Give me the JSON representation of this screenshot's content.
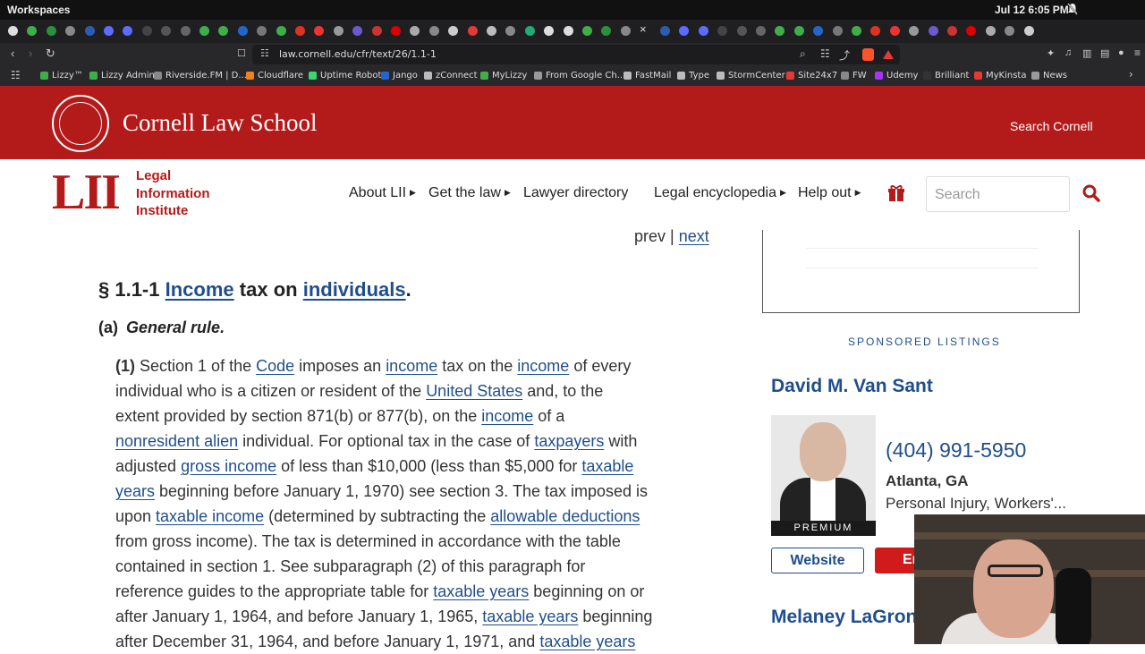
{
  "os": {
    "workspaces": "Workspaces",
    "clock": "Jul 12  6:05 PM"
  },
  "browser": {
    "close_tab_glyph": "×",
    "url": "law.cornell.edu/cfr/text/26/1.1-1",
    "bookmarks": [
      {
        "label": "Lizzy™",
        "color": "#3fae49"
      },
      {
        "label": "Lizzy Admin",
        "color": "#3fae49"
      },
      {
        "label": "Riverside.FM | D...",
        "color": "#888888"
      },
      {
        "label": "Cloudflare",
        "color": "#f38020"
      },
      {
        "label": "Uptime Robot",
        "color": "#3bd671"
      },
      {
        "label": "Jango",
        "color": "#2266cc"
      },
      {
        "label": "zConnect",
        "color": "#bbbbbb"
      },
      {
        "label": "MyLizzy",
        "color": "#3fae49"
      },
      {
        "label": "From Google Ch...",
        "color": "#999999"
      },
      {
        "label": "FastMail",
        "color": "#bbbbbb"
      },
      {
        "label": "Type",
        "color": "#bbbbbb"
      },
      {
        "label": "StormCenter",
        "color": "#bbbbbb"
      },
      {
        "label": "Site24x7",
        "color": "#e53935"
      },
      {
        "label": "FW",
        "color": "#888888"
      },
      {
        "label": "Udemy",
        "color": "#a435f0"
      },
      {
        "label": "Brilliant",
        "color": "#333333"
      },
      {
        "label": "MyKinsta",
        "color": "#e53935"
      },
      {
        "label": "News",
        "color": "#999999"
      }
    ]
  },
  "header": {
    "school": "Cornell Law School",
    "search_cornell": "Search Cornell"
  },
  "lii": {
    "letters": "LII",
    "line1": "Legal",
    "line2": "Information",
    "line3": "Institute"
  },
  "nav": {
    "items": [
      "About LII",
      "Get the law",
      "Lawyer directory",
      "Legal encyclopedia",
      "Help out"
    ],
    "search_placeholder": "Search"
  },
  "article": {
    "prev": "prev",
    "sep": "|",
    "next": "next",
    "section_prefix": "§ 1.1-1",
    "title_link1": "Income",
    "title_mid": "tax on",
    "title_link2": "individuals",
    "title_end": ".",
    "sub_label": "(a)",
    "sub_title": "General rule.",
    "para_label": "(1)",
    "lines": [
      [
        [
          "t",
          " Section 1 of the "
        ],
        [
          "l",
          "Code"
        ],
        [
          "t",
          " imposes an "
        ],
        [
          "l",
          "income"
        ],
        [
          "t",
          " tax on the "
        ],
        [
          "l",
          "income"
        ],
        [
          "t",
          " of every"
        ]
      ],
      [
        [
          "t",
          "individual who is a citizen or resident of the "
        ],
        [
          "l",
          "United States"
        ],
        [
          "t",
          " and, to the"
        ]
      ],
      [
        [
          "t",
          "extent provided by section 871(b) or 877(b), on the "
        ],
        [
          "l",
          "income"
        ],
        [
          "t",
          " of a"
        ]
      ],
      [
        [
          "l",
          "nonresident alien"
        ],
        [
          "t",
          " individual. For optional tax in the case of "
        ],
        [
          "l",
          "taxpayers"
        ],
        [
          "t",
          " with"
        ]
      ],
      [
        [
          "t",
          "adjusted "
        ],
        [
          "l",
          "gross income"
        ],
        [
          "t",
          " of less than $10,000 (less than $5,000 for "
        ],
        [
          "l",
          "taxable"
        ]
      ],
      [
        [
          "l",
          "years"
        ],
        [
          "t",
          " beginning before January 1, 1970) see section 3. The tax imposed is"
        ]
      ],
      [
        [
          "t",
          "upon "
        ],
        [
          "l",
          "taxable income"
        ],
        [
          "t",
          " (determined by subtracting the "
        ],
        [
          "l",
          "allowable deductions"
        ]
      ],
      [
        [
          "t",
          "from gross income). The tax is determined in accordance with the table"
        ]
      ],
      [
        [
          "t",
          "contained in section 1. See subparagraph (2) of this paragraph for"
        ]
      ],
      [
        [
          "t",
          "reference guides to the appropriate table for "
        ],
        [
          "l",
          "taxable years"
        ],
        [
          "t",
          " beginning on or"
        ]
      ],
      [
        [
          "t",
          "after January 1, 1964, and before January 1, 1965, "
        ],
        [
          "l",
          "taxable years"
        ],
        [
          "t",
          " beginning"
        ]
      ],
      [
        [
          "t",
          "after December 31, 1964, and before January 1, 1971, and "
        ],
        [
          "l",
          "taxable years"
        ]
      ]
    ]
  },
  "sidebar": {
    "sponsored": "SPONSORED LISTINGS",
    "lawyer1": {
      "name": "David M. Van Sant",
      "phone": "(404) 991-5950",
      "city": "Atlanta, GA",
      "practice": "Personal Injury, Workers'...",
      "badge": "PREMIUM",
      "website": "Website",
      "email": "Email"
    },
    "lawyer2": {
      "name": "Melaney LaGrone"
    }
  },
  "colors": {
    "brand_red": "#b31b1b",
    "link_blue": "#1f4e8c"
  }
}
